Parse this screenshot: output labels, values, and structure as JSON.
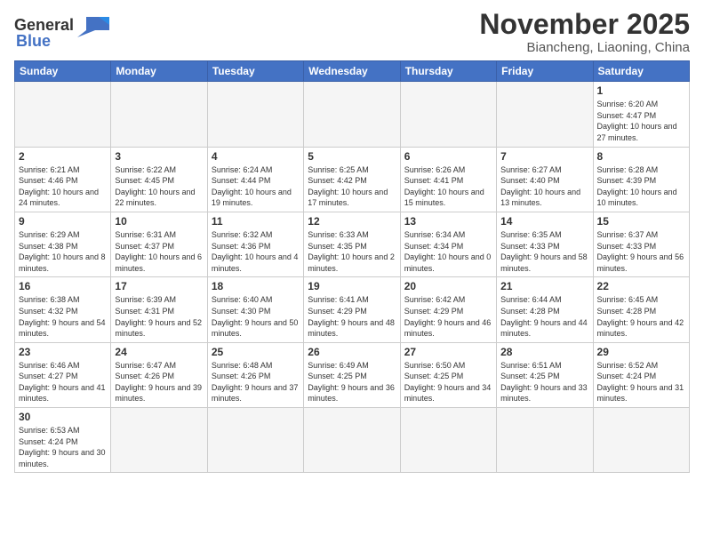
{
  "header": {
    "logo_general": "General",
    "logo_blue": "Blue",
    "month_title": "November 2025",
    "location": "Biancheng, Liaoning, China"
  },
  "days_of_week": [
    "Sunday",
    "Monday",
    "Tuesday",
    "Wednesday",
    "Thursday",
    "Friday",
    "Saturday"
  ],
  "weeks": [
    [
      {
        "day": "",
        "info": ""
      },
      {
        "day": "",
        "info": ""
      },
      {
        "day": "",
        "info": ""
      },
      {
        "day": "",
        "info": ""
      },
      {
        "day": "",
        "info": ""
      },
      {
        "day": "",
        "info": ""
      },
      {
        "day": "1",
        "info": "Sunrise: 6:20 AM\nSunset: 4:47 PM\nDaylight: 10 hours and 27 minutes."
      }
    ],
    [
      {
        "day": "2",
        "info": "Sunrise: 6:21 AM\nSunset: 4:46 PM\nDaylight: 10 hours and 24 minutes."
      },
      {
        "day": "3",
        "info": "Sunrise: 6:22 AM\nSunset: 4:45 PM\nDaylight: 10 hours and 22 minutes."
      },
      {
        "day": "4",
        "info": "Sunrise: 6:24 AM\nSunset: 4:44 PM\nDaylight: 10 hours and 19 minutes."
      },
      {
        "day": "5",
        "info": "Sunrise: 6:25 AM\nSunset: 4:42 PM\nDaylight: 10 hours and 17 minutes."
      },
      {
        "day": "6",
        "info": "Sunrise: 6:26 AM\nSunset: 4:41 PM\nDaylight: 10 hours and 15 minutes."
      },
      {
        "day": "7",
        "info": "Sunrise: 6:27 AM\nSunset: 4:40 PM\nDaylight: 10 hours and 13 minutes."
      },
      {
        "day": "8",
        "info": "Sunrise: 6:28 AM\nSunset: 4:39 PM\nDaylight: 10 hours and 10 minutes."
      }
    ],
    [
      {
        "day": "9",
        "info": "Sunrise: 6:29 AM\nSunset: 4:38 PM\nDaylight: 10 hours and 8 minutes."
      },
      {
        "day": "10",
        "info": "Sunrise: 6:31 AM\nSunset: 4:37 PM\nDaylight: 10 hours and 6 minutes."
      },
      {
        "day": "11",
        "info": "Sunrise: 6:32 AM\nSunset: 4:36 PM\nDaylight: 10 hours and 4 minutes."
      },
      {
        "day": "12",
        "info": "Sunrise: 6:33 AM\nSunset: 4:35 PM\nDaylight: 10 hours and 2 minutes."
      },
      {
        "day": "13",
        "info": "Sunrise: 6:34 AM\nSunset: 4:34 PM\nDaylight: 10 hours and 0 minutes."
      },
      {
        "day": "14",
        "info": "Sunrise: 6:35 AM\nSunset: 4:33 PM\nDaylight: 9 hours and 58 minutes."
      },
      {
        "day": "15",
        "info": "Sunrise: 6:37 AM\nSunset: 4:33 PM\nDaylight: 9 hours and 56 minutes."
      }
    ],
    [
      {
        "day": "16",
        "info": "Sunrise: 6:38 AM\nSunset: 4:32 PM\nDaylight: 9 hours and 54 minutes."
      },
      {
        "day": "17",
        "info": "Sunrise: 6:39 AM\nSunset: 4:31 PM\nDaylight: 9 hours and 52 minutes."
      },
      {
        "day": "18",
        "info": "Sunrise: 6:40 AM\nSunset: 4:30 PM\nDaylight: 9 hours and 50 minutes."
      },
      {
        "day": "19",
        "info": "Sunrise: 6:41 AM\nSunset: 4:29 PM\nDaylight: 9 hours and 48 minutes."
      },
      {
        "day": "20",
        "info": "Sunrise: 6:42 AM\nSunset: 4:29 PM\nDaylight: 9 hours and 46 minutes."
      },
      {
        "day": "21",
        "info": "Sunrise: 6:44 AM\nSunset: 4:28 PM\nDaylight: 9 hours and 44 minutes."
      },
      {
        "day": "22",
        "info": "Sunrise: 6:45 AM\nSunset: 4:28 PM\nDaylight: 9 hours and 42 minutes."
      }
    ],
    [
      {
        "day": "23",
        "info": "Sunrise: 6:46 AM\nSunset: 4:27 PM\nDaylight: 9 hours and 41 minutes."
      },
      {
        "day": "24",
        "info": "Sunrise: 6:47 AM\nSunset: 4:26 PM\nDaylight: 9 hours and 39 minutes."
      },
      {
        "day": "25",
        "info": "Sunrise: 6:48 AM\nSunset: 4:26 PM\nDaylight: 9 hours and 37 minutes."
      },
      {
        "day": "26",
        "info": "Sunrise: 6:49 AM\nSunset: 4:25 PM\nDaylight: 9 hours and 36 minutes."
      },
      {
        "day": "27",
        "info": "Sunrise: 6:50 AM\nSunset: 4:25 PM\nDaylight: 9 hours and 34 minutes."
      },
      {
        "day": "28",
        "info": "Sunrise: 6:51 AM\nSunset: 4:25 PM\nDaylight: 9 hours and 33 minutes."
      },
      {
        "day": "29",
        "info": "Sunrise: 6:52 AM\nSunset: 4:24 PM\nDaylight: 9 hours and 31 minutes."
      }
    ],
    [
      {
        "day": "30",
        "info": "Sunrise: 6:53 AM\nSunset: 4:24 PM\nDaylight: 9 hours and 30 minutes."
      },
      {
        "day": "",
        "info": ""
      },
      {
        "day": "",
        "info": ""
      },
      {
        "day": "",
        "info": ""
      },
      {
        "day": "",
        "info": ""
      },
      {
        "day": "",
        "info": ""
      },
      {
        "day": "",
        "info": ""
      }
    ]
  ]
}
